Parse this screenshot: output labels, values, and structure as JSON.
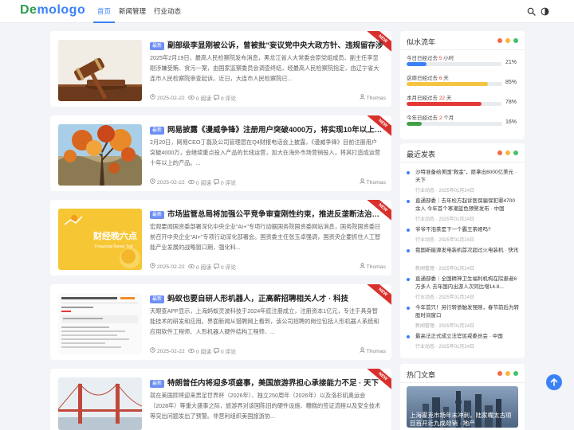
{
  "brand": {
    "logo_text": "Demologo",
    "accent": "#3b82f6",
    "logo_colors": [
      "#2d9e4e",
      "#3b82f6"
    ]
  },
  "nav": [
    {
      "label": "首页",
      "active": true
    },
    {
      "label": "新闻管理",
      "active": false
    },
    {
      "label": "行业动态",
      "active": false
    }
  ],
  "header_icons": [
    "search-icon",
    "theme-toggle-icon"
  ],
  "articles": [
    {
      "ribbon": "NEW",
      "badge": "最新",
      "title": "副部级李显刚被公诉，曾被批\"妄议党中央大政方针、违规留存涉",
      "summary": "2025年2月19日，最高人民检察院发布消息，黑龙江省人大常委会原党组成员、副主任李显刚涉嫌受贿、贪污一案，由国家监察委员会调查终结，经最高人民检察院指定，由辽宁省大连市人民检察院审查起诉。近日，大连市人民检察院已...",
      "date": "2025-02-22",
      "reads": "0 阅读",
      "comments": "0 评论",
      "author": "Thomas",
      "image": "gavel"
    },
    {
      "ribbon": "NEW",
      "badge": "最新",
      "title": "网易披露《漫威争锋》注册用户突破4000万，将实现10年以上运营",
      "summary": "2月20日，网易CEO丁磊及公司管理层在Q4财报电话会上披露，《漫威争锋》目前注册用户突破4000万，会继续重点投入产品的长线运营，加大在海外市场营销投入，将其打造成运营十年以上的产品。...",
      "date": "2025-02-22",
      "reads": "0 阅读",
      "comments": "0 评论",
      "author": "Thomas",
      "image": "autumn"
    },
    {
      "ribbon": "NEW",
      "badge": "最新",
      "title": "市场监管总局将加强公平竞争审查刚性约束，推进反垄断法治监管",
      "summary": "宏观要闻国资委部署深化中央企业\"AI+\"专项行动据国务院国资委网站消息，国务院国资委日前召开中央企业\"AI+\"专项行动深化部署会。国资委主任张玉卓强调，国资央企要抓住人工智能产业发展的战略窗口期，强化科...",
      "date": "2025-02-22",
      "reads": "0 阅读",
      "comments": "0 评论",
      "author": "Thomas",
      "image": "finance",
      "image_text_cn": "财经晚六点",
      "image_text_en": "Financial News Tod"
    },
    {
      "ribbon": "NEW",
      "badge": "最新",
      "title": "蚂蚁也要自研人形机器人，正高薪招聘相关人才 · 科技",
      "summary": "天眼查APP显示，上海蚂蚁灵波科技于2024年底注册成立，注册资本1亿元，专注于具身智能技术的研发和应用。界面新闻从猎聘网上看到，该公司招聘的岗位包括人形机器人系统和应用软件工程师、人形机器人硬件结构工程师、...",
      "date": "2025-02-22",
      "reads": "0 阅读",
      "comments": "0 评论",
      "author": "Thomas",
      "image": "screenshot"
    },
    {
      "ribbon": "NEW",
      "badge": "最新",
      "title": "特朗普任内将迎多项盛事，美国旅游界担心承接能力不足 · 天下",
      "summary": "就在美国即将迎来男足世界杯（2026年）、独立250周年（2026年）以及洛杉矶奥运会（2028年）等重大盛事之际，旅游界对该国陈旧的硬件设施、糟糕的签证流程以及安全技术等突出问题发出了预警。非营利组织美国旅游协...",
      "date": "",
      "reads": "",
      "comments": "",
      "author": "",
      "image": "bridge"
    }
  ],
  "time_panel": {
    "title": "似水流年",
    "items": [
      {
        "prefix": "今日已经过去",
        "value": "5",
        "unit": "小时",
        "percent": "21%",
        "fill": 0.21,
        "color": "#3b82f6"
      },
      {
        "prefix": "这周已经过去",
        "value": "6",
        "unit": "天",
        "percent": "85%",
        "fill": 0.85,
        "color": "#f5c542"
      },
      {
        "prefix": "本月已经过去",
        "value": "22",
        "unit": "天",
        "percent": "78%",
        "fill": 0.78,
        "color": "#e53935"
      },
      {
        "prefix": "今年已经过去",
        "value": "2",
        "unit": "个月",
        "percent": "16%",
        "fill": 0.16,
        "color": "#43a047"
      }
    ]
  },
  "latest_panel": {
    "title": "最近发表",
    "items": [
      {
        "title": "沙特准备给美国\"救金\"，愿拿出6000亿美元 · 天下",
        "category": "行业动态",
        "date": "2025年01月24日"
      },
      {
        "title": "直通部委｜去年检方起诉医保骗保犯罪4700余人 今年首个寒潮蓝色预警发布 · 中国",
        "category": "行业动态",
        "date": "2025年01月24日"
      },
      {
        "title": "爷爷不泡茶是下一个霸王茶姬吗?",
        "category": "行业动态",
        "date": "2025年01月24日"
      },
      {
        "title": "我国新能源发电装机首次超过火电装机 · 快讯",
        "category": "新闻管理",
        "date": "2025年01月24日"
      },
      {
        "title": "直通部委｜全国精神卫生福利机构在院患者6万多人 去年国内出游人次同比增14.8...",
        "category": "行业动态",
        "date": "2025年01月24日"
      },
      {
        "title": "今年首只！另行转债触发强赎，春节前后为转股时间窗口",
        "category": "新闻管理",
        "date": "2025年01月24日"
      },
      {
        "title": "最高法正式成立法官惩戒委员会 · 中国",
        "category": "行业动态",
        "date": "2025年01月24日"
      }
    ]
  },
  "hot_panel": {
    "title": "热门文章",
    "caption": "上海霍克市场年末冲刺，陆家嘴太古项目首开近九成劲销 · 地产"
  },
  "panel_dots": [
    "#f4694a",
    "#f5b83c",
    "#43c26a"
  ],
  "back_to_top_icon": "arrow-up-icon"
}
